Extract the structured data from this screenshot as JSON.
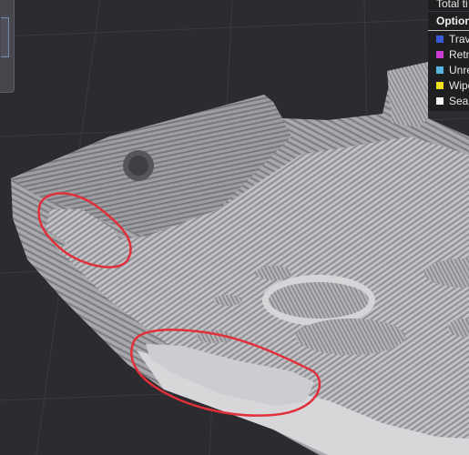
{
  "legend": {
    "total_label": "Total ti",
    "header": "Option",
    "items": [
      {
        "label": "Trav",
        "color": "#3b5bd6"
      },
      {
        "label": "Retra",
        "color": "#c83cd0"
      },
      {
        "label": "Unre",
        "color": "#52b6e0"
      },
      {
        "label": "Wipe",
        "color": "#f0e020"
      },
      {
        "label": "Sear",
        "color": "#f2f2f2"
      }
    ]
  },
  "annotation": {
    "stroke_color": "#e0303a"
  }
}
